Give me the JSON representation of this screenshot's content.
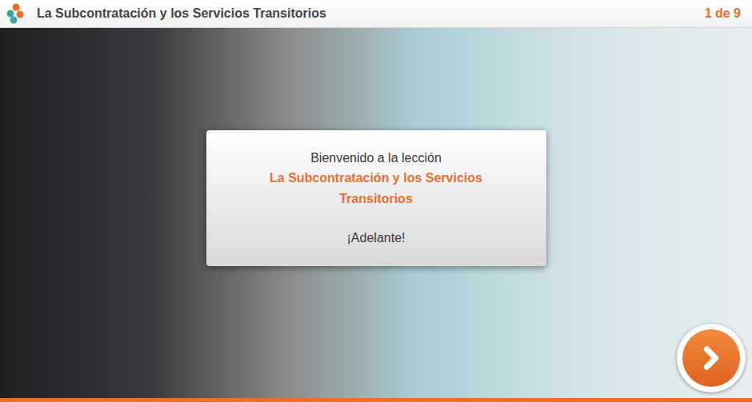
{
  "header": {
    "title": "La Subcontratación y los Servicios Transitorios",
    "page": "1 de 9"
  },
  "dialog": {
    "greeting": "Bienvenido a la lección",
    "lesson_title": "La Subcontratación y los Servicios Transitorios",
    "prompt": "¡Adelante!"
  }
}
